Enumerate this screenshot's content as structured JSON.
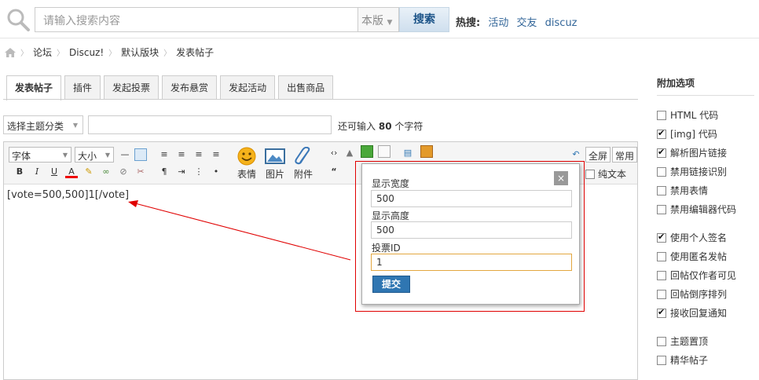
{
  "search": {
    "placeholder": "请输入搜索内容",
    "scope": "本版",
    "button": "搜索"
  },
  "hotwords": {
    "label": "热搜:",
    "items": [
      "活动",
      "交友",
      "discuz"
    ]
  },
  "breadcrumb": [
    "论坛",
    "Discuz!",
    "默认版块",
    "发表帖子"
  ],
  "tabs": [
    "发表帖子",
    "插件",
    "发起投票",
    "发布悬赏",
    "发起活动",
    "出售商品"
  ],
  "subject": {
    "type_select": "选择主题分类",
    "hint_pre": "还可输入",
    "hint_num": "80",
    "hint_post": "个字符"
  },
  "toolbar": {
    "font": "字体",
    "size": "大小",
    "emoticon": "表情",
    "image": "图片",
    "attachment": "附件",
    "fullscreen": "全屏",
    "common": "常用",
    "plaintext": "纯文本"
  },
  "editor_content": "[vote=500,500]1[/vote]",
  "popup": {
    "width_label": "显示宽度",
    "width_value": "500",
    "height_label": "显示高度",
    "height_value": "500",
    "id_label": "投票ID",
    "id_value": "1",
    "submit": "提交",
    "close": "×"
  },
  "sidebar": {
    "title": "附加选项",
    "options": [
      {
        "label": "HTML 代码",
        "checked": false
      },
      {
        "label": "[img] 代码",
        "checked": true
      },
      {
        "label": "解析图片链接",
        "checked": true
      },
      {
        "label": "禁用链接识别",
        "checked": false
      },
      {
        "label": "禁用表情",
        "checked": false
      },
      {
        "label": "禁用编辑器代码",
        "checked": false
      },
      {
        "label": "使用个人签名",
        "checked": true
      },
      {
        "label": "使用匿名发帖",
        "checked": false
      },
      {
        "label": "回帖仅作者可见",
        "checked": false
      },
      {
        "label": "回帖倒序排列",
        "checked": false
      },
      {
        "label": "接收回复通知",
        "checked": true
      },
      {
        "label": "主题置顶",
        "checked": false
      },
      {
        "label": "精华帖子",
        "checked": false
      }
    ]
  },
  "colors": {
    "annotation": "#e00000",
    "accent": "#2f76b2",
    "link": "#336699"
  }
}
